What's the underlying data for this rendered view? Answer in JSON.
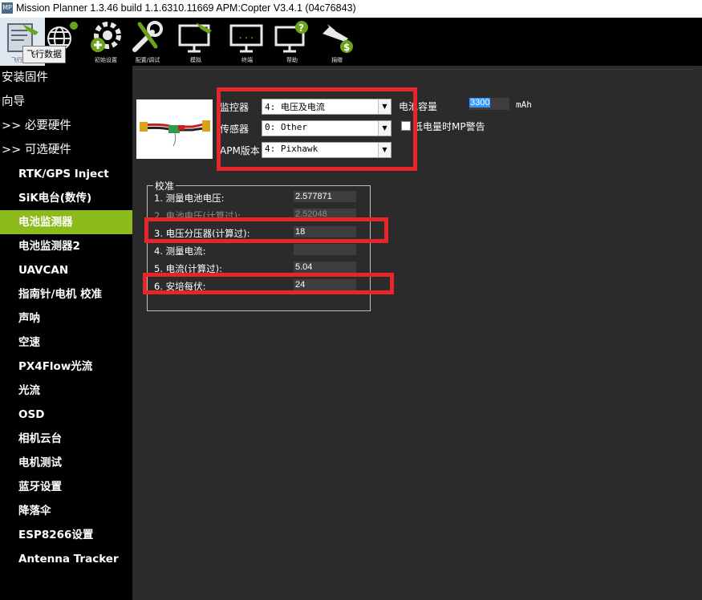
{
  "window": {
    "title": "Mission Planner 1.3.46 build 1.1.6310.11669 APM:Copter V3.4.1 (04c76843)",
    "icon_text": "MP"
  },
  "toolbar": {
    "tooltip": "飞行数据",
    "buttons": [
      {
        "label": "飞行数据",
        "icon": "flight-data-icon"
      },
      {
        "label": "",
        "icon": "map-globe-icon"
      },
      {
        "label": "初始设置",
        "icon": "initial-setup-icon"
      },
      {
        "label": "配置/调试",
        "icon": "config-tuning-icon"
      },
      {
        "label": "模拟",
        "icon": "simulation-icon"
      },
      {
        "label": "终端",
        "icon": "terminal-icon"
      },
      {
        "label": "帮助",
        "icon": "help-icon"
      },
      {
        "label": "捐赠",
        "icon": "donate-icon"
      }
    ]
  },
  "sidebar": {
    "items": [
      {
        "label": "安装固件"
      },
      {
        "label": "向导"
      },
      {
        "label": ">> 必要硬件"
      },
      {
        "label": ">> 可选硬件"
      },
      {
        "label": "RTK/GPS Inject"
      },
      {
        "label": "SiK电台(数传)"
      },
      {
        "label": "电池监测器"
      },
      {
        "label": "电池监测器2"
      },
      {
        "label": "UAVCAN"
      },
      {
        "label": "指南针/电机 校准"
      },
      {
        "label": "声呐"
      },
      {
        "label": "空速"
      },
      {
        "label": "PX4Flow光流"
      },
      {
        "label": "光流"
      },
      {
        "label": "OSD"
      },
      {
        "label": "相机云台"
      },
      {
        "label": "电机测试"
      },
      {
        "label": "蓝牙设置"
      },
      {
        "label": "降落伞"
      },
      {
        "label": "ESP8266设置"
      },
      {
        "label": "Antenna Tracker"
      }
    ],
    "active_item": "电池监测器"
  },
  "battery": {
    "monitor_label": "监控器",
    "monitor_value": "4: 电压及电流",
    "sensor_label": "传感器",
    "sensor_value": "0: Other",
    "apm_label": "APM版本",
    "apm_value": "4: Pixhawk",
    "capacity_label": "电池容量",
    "capacity_value": "3300",
    "capacity_unit": "mAh",
    "warn_label": "低电量时MP警告"
  },
  "calibration": {
    "title": "校准",
    "rows": [
      {
        "label": "1. 测量电池电压:",
        "value": "2.577871"
      },
      {
        "label": "2. 电池电压(计算过):",
        "value": "2.52048"
      },
      {
        "label": "3. 电压分压器(计算过):",
        "value": "18"
      },
      {
        "label": "4. 测量电流:",
        "value": ""
      },
      {
        "label": "5. 电流(计算过):",
        "value": "5.04"
      },
      {
        "label": "6. 安培每伏:",
        "value": "24"
      }
    ]
  },
  "colors": {
    "accent": "#8dbb1b",
    "highlight": "#e6262b",
    "background": "#2b2b2b",
    "sidebar": "#000000"
  }
}
